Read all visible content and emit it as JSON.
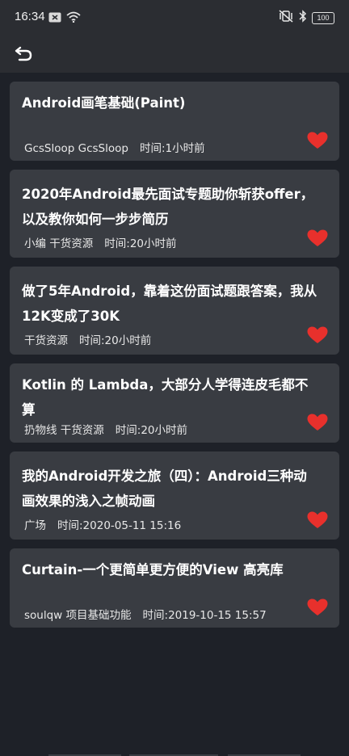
{
  "status_bar": {
    "time": "16:34",
    "battery": "100",
    "icons": [
      "message-icon",
      "wifi-icon",
      "vibrate-icon",
      "bluetooth-icon",
      "battery-icon"
    ]
  },
  "toolbar": {
    "back_icon": "undo-back-icon"
  },
  "colors": {
    "background": "#1e2128",
    "card": "#393c42",
    "bar": "#2b2d32",
    "heart": "#e8302c"
  },
  "articles": [
    {
      "title": "Android画笔基础(Paint)",
      "author": "GcsSloop GcsSloop",
      "time": "时间:1小时前",
      "favorite": true
    },
    {
      "title": "2020年Android最先面试专题助你斩获offer，以及教你如何一步步简历",
      "author": "小编 干货资源",
      "time": "时间:20小时前",
      "favorite": true
    },
    {
      "title": "做了5年Android，靠着这份面试题跟答案，我从12K变成了30K",
      "author": "干货资源",
      "time": "时间:20小时前",
      "favorite": true
    },
    {
      "title": "Kotlin 的 Lambda，大部分人学得连皮毛都不算",
      "author": "扔物线 干货资源",
      "time": "时间:20小时前",
      "favorite": true
    },
    {
      "title": "我的Android开发之旅（四）：Android三种动画效果的浅入之帧动画",
      "author": "广场",
      "time": "时间:2020-05-11 15:16",
      "favorite": true
    },
    {
      "title": "Curtain-一个更简单更方便的View 高亮库",
      "author": "soulqw 项目基础功能",
      "time": "时间:2019-10-15 15:57",
      "favorite": true
    }
  ]
}
